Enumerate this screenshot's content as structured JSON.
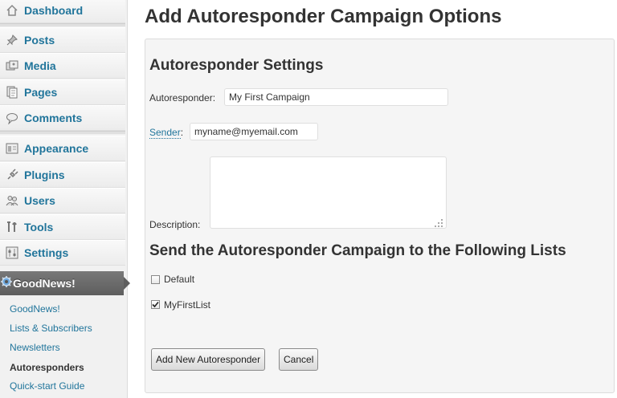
{
  "sidebar": {
    "items": [
      {
        "label": "Dashboard",
        "icon": "dashboard-icon"
      },
      {
        "label": "Posts",
        "icon": "pushpin-icon"
      },
      {
        "label": "Media",
        "icon": "media-icon"
      },
      {
        "label": "Pages",
        "icon": "pages-icon"
      },
      {
        "label": "Comments",
        "icon": "comment-bubble-icon"
      },
      {
        "label": "Appearance",
        "icon": "appearance-icon"
      },
      {
        "label": "Plugins",
        "icon": "plugin-icon"
      },
      {
        "label": "Users",
        "icon": "users-icon"
      },
      {
        "label": "Tools",
        "icon": "tools-icon"
      },
      {
        "label": "Settings",
        "icon": "settings-icon"
      }
    ],
    "goodnews": {
      "label": "GoodNews!",
      "icon": "gear-icon"
    },
    "submenu": [
      {
        "label": "GoodNews!"
      },
      {
        "label": "Lists & Subscribers"
      },
      {
        "label": "Newsletters"
      },
      {
        "label": "Autoresponders",
        "current": true
      },
      {
        "label": "Quick-start Guide"
      }
    ]
  },
  "page": {
    "title": "Add Autoresponder Campaign Options"
  },
  "settings": {
    "heading": "Autoresponder Settings",
    "autoresponder_label": "Autoresponder:",
    "autoresponder_value": "My First Campaign",
    "sender_label": "Sender",
    "sender_colon": ":",
    "sender_value": "myname@myemail.com",
    "description_label": "Description:",
    "description_value": ""
  },
  "lists": {
    "heading": "Send the Autoresponder Campaign to the Following Lists",
    "items": [
      {
        "label": "Default",
        "checked": false
      },
      {
        "label": "MyFirstList",
        "checked": true
      }
    ]
  },
  "actions": {
    "add_label": "Add New Autoresponder",
    "cancel_label": "Cancel"
  },
  "colors": {
    "link": "#21759b",
    "active_menu": "#6d6d6d"
  }
}
